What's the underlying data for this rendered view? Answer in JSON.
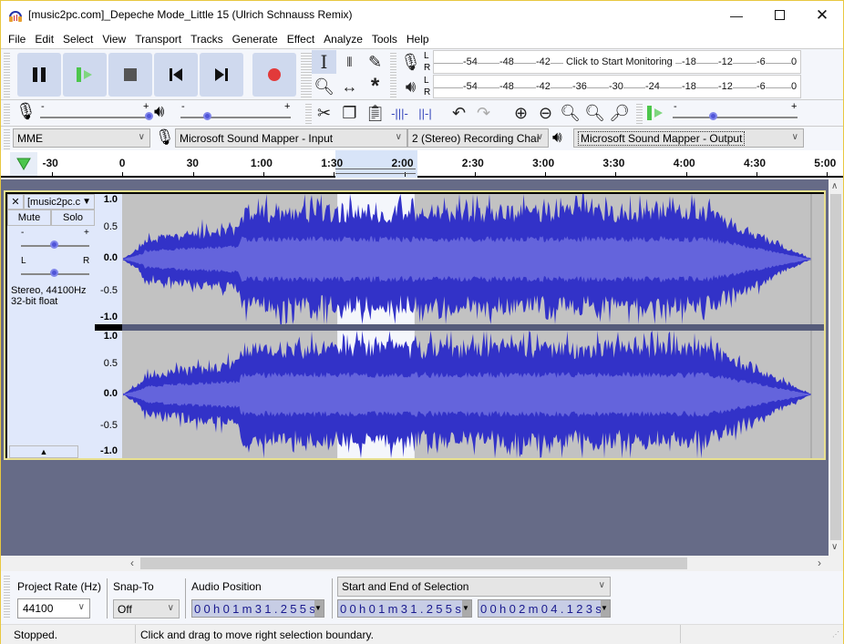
{
  "window": {
    "title": "[music2pc.com]_Depeche Mode_Little 15 (Ulrich Schnauss Remix)",
    "controls": [
      "minimize",
      "maximize",
      "close"
    ]
  },
  "menu": [
    "File",
    "Edit",
    "Select",
    "View",
    "Transport",
    "Tracks",
    "Generate",
    "Effect",
    "Analyze",
    "Tools",
    "Help"
  ],
  "transport": {
    "buttons": [
      "pause",
      "play",
      "stop",
      "skip-to-start",
      "skip-to-end",
      "record"
    ]
  },
  "tools": {
    "row1": [
      "selection-tool",
      "envelope-tool",
      "draw-tool"
    ],
    "row2": [
      "zoom-tool",
      "time-shift-tool",
      "multi-tool"
    ]
  },
  "meters": {
    "record": {
      "channels": [
        "L",
        "R"
      ],
      "ticks": [
        "-54",
        "-48",
        "-42",
        "-18",
        "-12",
        "-6",
        "0"
      ],
      "prompt": "Click to Start Monitoring"
    },
    "playback": {
      "channels": [
        "L",
        "R"
      ],
      "ticks": [
        "-54",
        "-48",
        "-42",
        "-36",
        "-30",
        "-24",
        "-18",
        "-12",
        "-6",
        "0"
      ]
    }
  },
  "mixer": {
    "record_volume": {
      "min": "-",
      "max": "+",
      "value": 1.0
    },
    "playback_volume": {
      "min": "-",
      "max": "+",
      "value": 0.25
    }
  },
  "edit_toolbar": [
    "cut",
    "copy",
    "paste",
    "trim-audio",
    "silence-audio",
    "undo",
    "redo",
    "zoom-in",
    "zoom-out",
    "fit-selection",
    "fit-project",
    "zoom-toggle"
  ],
  "play_at_speed": {
    "min": "-",
    "max": "+",
    "value": 0.33
  },
  "devices": {
    "host": "MME",
    "input": "Microsoft Sound Mapper - Input",
    "channels": "2 (Stereo) Recording Chai",
    "output": "Microsoft Sound Mapper - Output"
  },
  "ruler": {
    "ticks": [
      "-30",
      "0",
      "30",
      "1:00",
      "1:30",
      "2:00",
      "2:30",
      "3:00",
      "3:30",
      "4:00",
      "4:30",
      "5:00"
    ]
  },
  "track": {
    "name": "[music2pc.c",
    "mute": "Mute",
    "solo": "Solo",
    "gain": {
      "min": "-",
      "max": "+",
      "value": 0.5
    },
    "pan": {
      "min": "L",
      "max": "R",
      "value": 0.5
    },
    "info_line1": "Stereo, 44100Hz",
    "info_line2": "32-bit float",
    "scale": [
      "1.0",
      "0.5",
      "0.0",
      "-0.5",
      "-1.0"
    ],
    "selection_start_s": 91.255,
    "selection_end_s": 124.123
  },
  "selection_toolbar": {
    "project_rate_label": "Project Rate (Hz)",
    "project_rate": "44100",
    "snap_label": "Snap-To",
    "snap": "Off",
    "audio_position_label": "Audio Position",
    "audio_position": "00h01m31.255s",
    "selection_mode": "Start and End of Selection",
    "selection_start": "00h01m31.255s",
    "selection_end": "00h02m04.123s"
  },
  "status": {
    "state": "Stopped.",
    "hint": "Click and drag to move right selection boundary."
  },
  "colors": {
    "waveform": "#3232c8",
    "waveform_rms": "#6464dc",
    "selection": "#ffffff",
    "background": "#c2c2c2",
    "record": "#e23a3a",
    "play": "#4cc64c"
  }
}
